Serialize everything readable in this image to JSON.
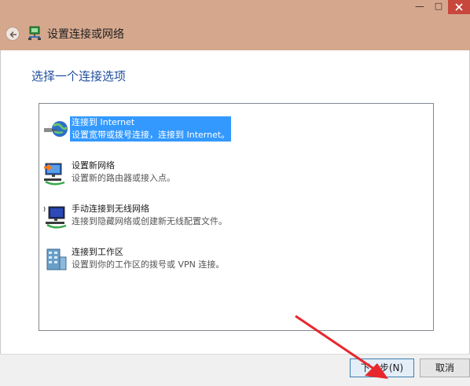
{
  "window": {
    "title": "设置连接或网络",
    "minimize_glyph": "—",
    "maximize_glyph": "□"
  },
  "heading": "选择一个连接选项",
  "options": [
    {
      "title": "连接到 Internet",
      "desc": "设置宽带或拨号连接，连接到 Internet。",
      "icon": "globe-network-icon",
      "selected": true
    },
    {
      "title": "设置新网络",
      "desc": "设置新的路由器或接入点。",
      "icon": "new-network-icon",
      "selected": false
    },
    {
      "title": "手动连接到无线网络",
      "desc": "连接到隐藏网络或创建新无线配置文件。",
      "icon": "wireless-network-icon",
      "selected": false
    },
    {
      "title": "连接到工作区",
      "desc": "设置到你的工作区的拨号或 VPN 连接。",
      "icon": "workplace-icon",
      "selected": false
    }
  ],
  "buttons": {
    "next": "下一步(N)",
    "cancel": "取消"
  },
  "colors": {
    "titlebar": "#d5a88e",
    "heading": "#1f4e9c",
    "selection": "#3399ff",
    "close": "#c8473c",
    "annotation_arrow": "#e8262d"
  }
}
